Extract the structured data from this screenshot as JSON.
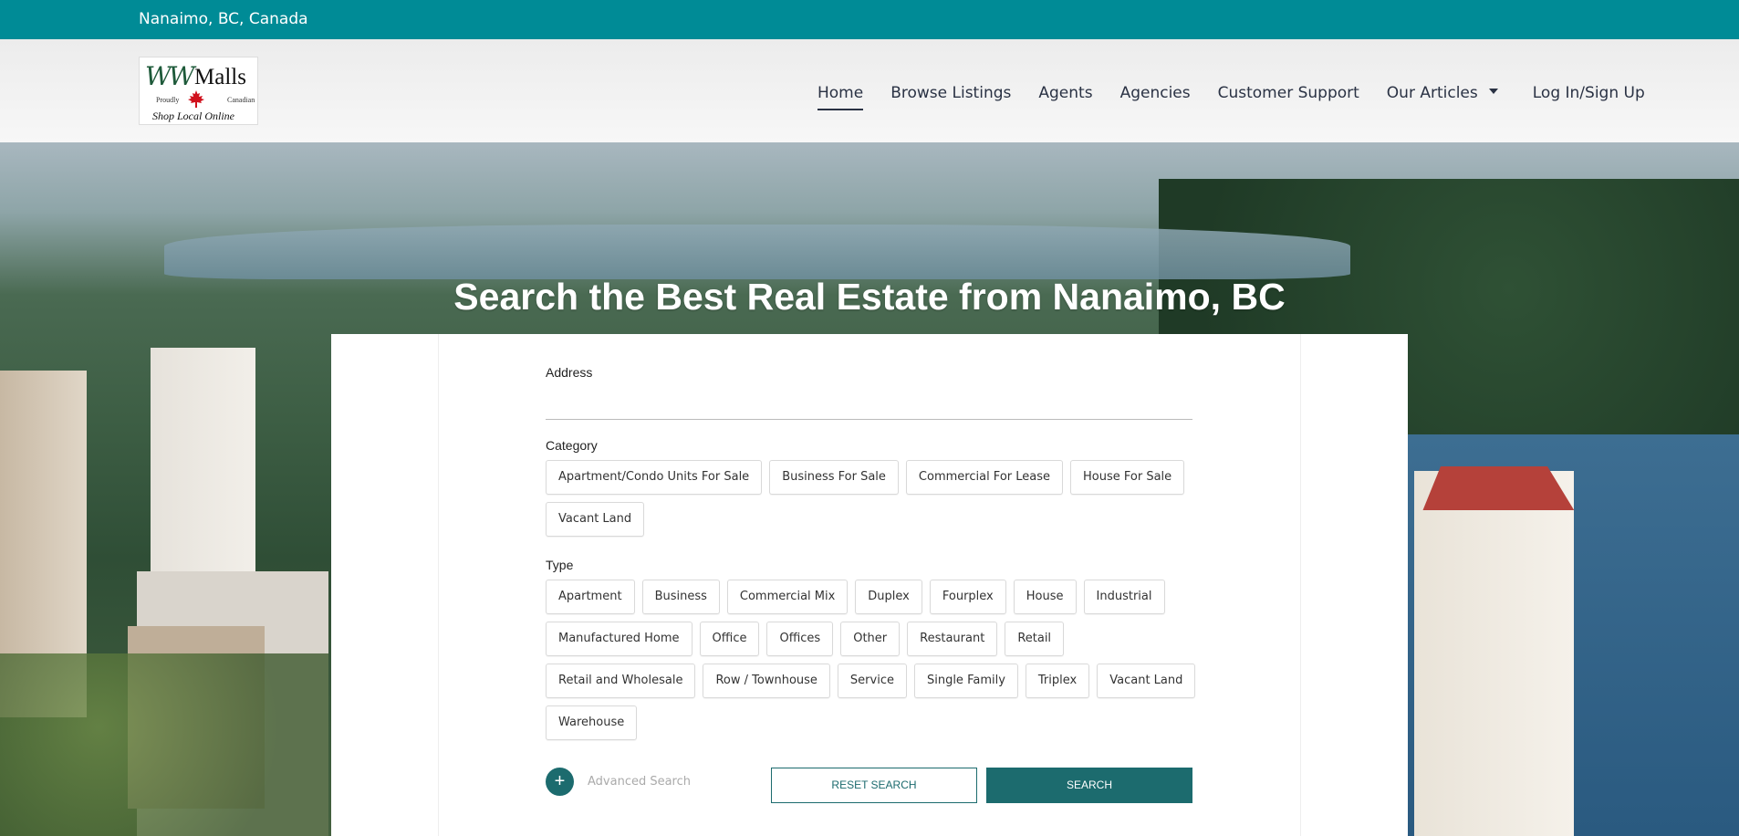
{
  "topbar": {
    "location": "Nanaimo, BC, Canada"
  },
  "brand": {
    "logo_ww": "WW",
    "logo_malls": "Malls",
    "logo_left": "Proudly",
    "logo_right": "Canadian",
    "logo_tagline": "Shop Local Online"
  },
  "nav": {
    "items": [
      "Home",
      "Browse Listings",
      "Agents",
      "Agencies",
      "Customer Support",
      "Our Articles",
      "Log In/Sign Up"
    ],
    "active": "Home"
  },
  "hero": {
    "title": "Search the Best Real Estate from Nanaimo, BC"
  },
  "search": {
    "address_label": "Address",
    "address_value": "",
    "category_label": "Category",
    "categories": [
      "Apartment/Condo Units For Sale",
      "Business For Sale",
      "Commercial For Lease",
      "House For Sale",
      "Vacant Land"
    ],
    "type_label": "Type",
    "types": [
      "Apartment",
      "Business",
      "Commercial Mix",
      "Duplex",
      "Fourplex",
      "House",
      "Industrial",
      "Manufactured Home",
      "Office",
      "Offices",
      "Other",
      "Restaurant",
      "Retail",
      "Retail and Wholesale",
      "Row / Townhouse",
      "Service",
      "Single Family",
      "Triplex",
      "Vacant Land",
      "Warehouse"
    ],
    "advanced_icon": "+",
    "advanced_label": "Advanced Search",
    "reset_label": "RESET SEARCH",
    "search_label": "SEARCH"
  },
  "colors": {
    "topbar": "#008b96",
    "accent": "#1c6b6e",
    "nav_text": "#2a3244"
  },
  "icons": {
    "dropdown": "chevron-down-icon",
    "leaf": "maple-leaf-icon",
    "add": "plus-icon"
  }
}
